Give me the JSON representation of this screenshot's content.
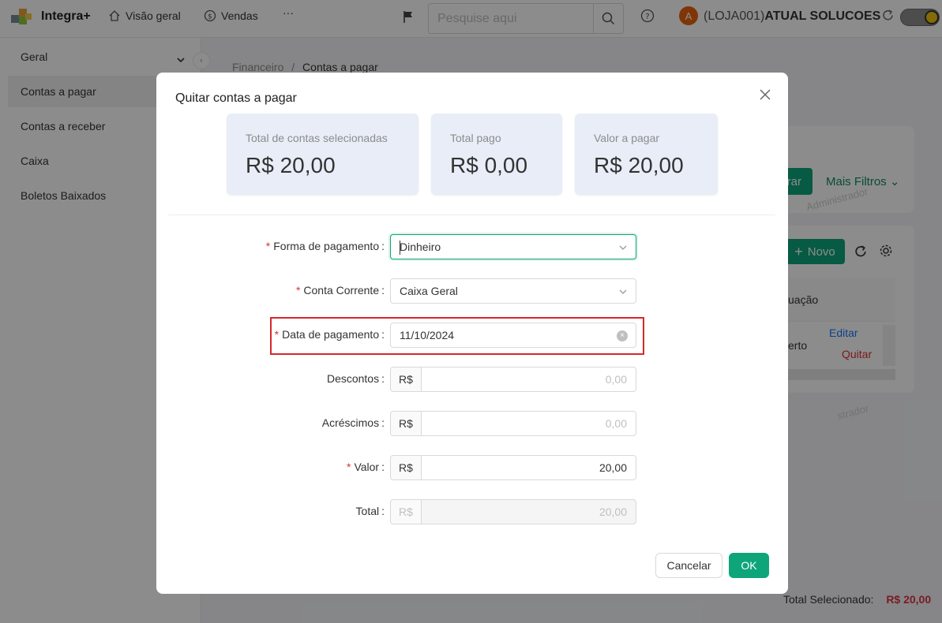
{
  "app": {
    "brand": "Integra+",
    "nav": [
      {
        "label": "Visão geral",
        "icon": "home-icon"
      },
      {
        "label": "Vendas",
        "icon": "dollar-circle-icon"
      },
      {
        "label": "···",
        "icon": "more-icon"
      }
    ],
    "search_placeholder": "Pesquise aqui",
    "avatar_letter": "A",
    "user_prefix": "(LOJA001)",
    "user_name": "ATUAL SOLUCOES"
  },
  "sidebar": {
    "items": [
      {
        "label": "Geral"
      },
      {
        "label": "Contas a pagar"
      },
      {
        "label": "Contas a receber"
      },
      {
        "label": "Caixa"
      },
      {
        "label": "Boletos Baixados"
      }
    ]
  },
  "background": {
    "breadcrumb": {
      "root": "Financeiro",
      "separator": "/",
      "current": "Contas a pagar"
    },
    "filter_button": "rar",
    "more_filters": "Mais Filtros",
    "new_button": "Novo",
    "table_header": "uação",
    "row_status": "erto",
    "row_edit": "Editar",
    "row_settle": "Quitar",
    "watermark": "Administrador",
    "watermark2": "strador",
    "total_selected_label": "Total Selecionado:",
    "total_selected_value": "R$ 20,00"
  },
  "modal": {
    "title": "Quitar contas a pagar",
    "stats": [
      {
        "label": "Total de contas selecionadas",
        "value": "R$ 20,00"
      },
      {
        "label": "Total pago",
        "value": "R$ 0,00"
      },
      {
        "label": "Valor a pagar",
        "value": "R$ 20,00"
      }
    ],
    "fields": {
      "forma_pagamento": {
        "label": "Forma de pagamento",
        "value": "Dinheiro",
        "required": true
      },
      "conta_corrente": {
        "label": "Conta Corrente",
        "value": "Caixa Geral",
        "required": true
      },
      "data_pagamento": {
        "label": "Data de pagamento",
        "value": "11/10/2024",
        "required": true
      },
      "descontos": {
        "label": "Descontos",
        "prefix": "R$",
        "placeholder": "0,00"
      },
      "acrescimos": {
        "label": "Acréscimos",
        "prefix": "R$",
        "placeholder": "0,00"
      },
      "valor": {
        "label": "Valor",
        "prefix": "R$",
        "value": "20,00",
        "required": true
      },
      "total": {
        "label": "Total",
        "prefix": "R$",
        "value": "20,00"
      }
    },
    "required_mark": "*",
    "label_suffix": ":",
    "cancel_label": "Cancelar",
    "ok_label": "OK"
  },
  "colors": {
    "primary": "#0ea57a",
    "danger": "#d9262f",
    "stat_bg": "#e8edf7",
    "avatar": "#e8620c"
  }
}
